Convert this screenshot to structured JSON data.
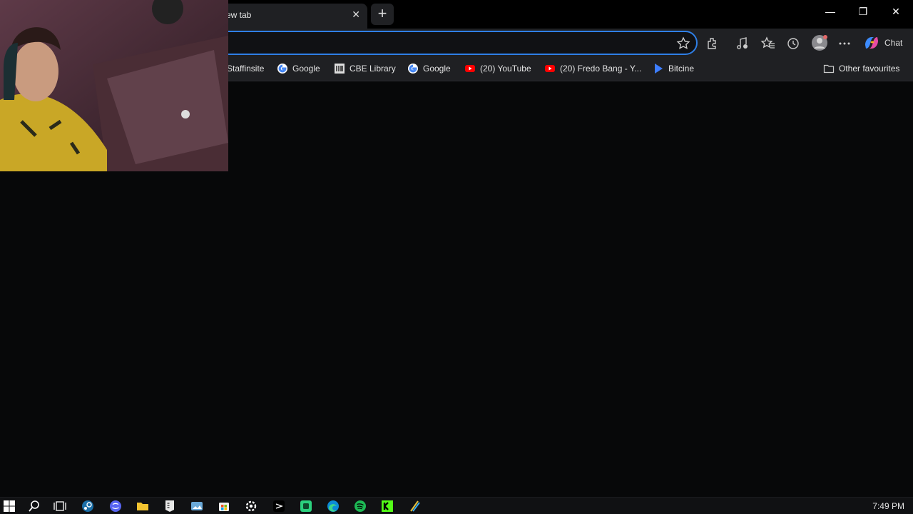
{
  "browser": {
    "tab": {
      "title": "ew tab",
      "close_glyph": "✕"
    },
    "new_tab_glyph": "+",
    "window_controls": {
      "minimize": "—",
      "restore": "❐",
      "close": "✕"
    },
    "address_bar": {
      "value": "",
      "placeholder": ""
    },
    "toolbar_icons": [
      "star-icon",
      "extensions-icon",
      "read-aloud-icon",
      "favorites-icon",
      "history-icon",
      "profile-icon",
      "more-icon"
    ],
    "chat_label": "Chat",
    "bookmarks": [
      {
        "label": "Staffinsite",
        "icon": "blank"
      },
      {
        "label": "Google",
        "icon": "google"
      },
      {
        "label": "CBE Library",
        "icon": "library"
      },
      {
        "label": "Google",
        "icon": "google"
      },
      {
        "label": "(20) YouTube",
        "icon": "youtube"
      },
      {
        "label": "(20) Fredo Bang - Y...",
        "icon": "youtube"
      },
      {
        "label": "Bitcine",
        "icon": "bitcine"
      }
    ],
    "other_favourites": "Other favourites"
  },
  "taskbar": {
    "apps": [
      "start-icon",
      "search-icon",
      "task-view-icon",
      "steam-icon",
      "discord-icon",
      "file-explorer-icon",
      "epic-games-icon",
      "photos-icon",
      "store-icon",
      "settings-icon",
      "capcut-icon",
      "app-green-icon",
      "edge-icon",
      "spotify-icon",
      "kick-icon",
      "app-pen-icon"
    ],
    "clock": "7:49 PM"
  },
  "colors": {
    "accent": "#2f7fe6",
    "background": "#070809",
    "toolbar": "#1f2023"
  }
}
